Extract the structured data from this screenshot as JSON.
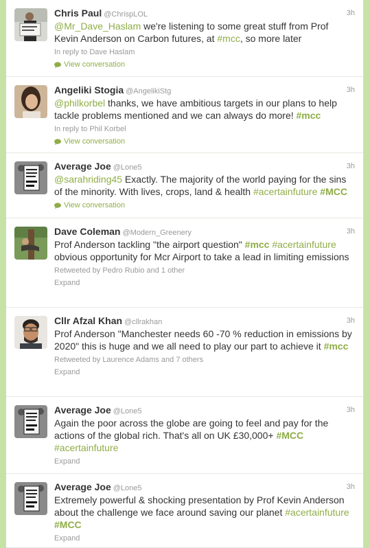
{
  "colors": {
    "accent": "#8fad46",
    "background": "#c6e2a6",
    "muted": "#999999",
    "text": "#333333"
  },
  "tweets": [
    {
      "name": "Chris Paul",
      "handle": "@ChrispLOL",
      "time": "3h",
      "text": {
        "mention": "@Mr_Dave_Haslam",
        "body1": " we're listening to some great stuff from Prof Kevin Anderson on Carbon futures, at ",
        "tag1": "#mcc",
        "body2": ", so more later"
      },
      "meta": "In reply to Dave Haslam",
      "action": "View conversation",
      "avatar_icon": "person-holding-sign-icon"
    },
    {
      "name": "Angeliki Stogia",
      "handle": "@AngelikiStg",
      "time": "3h",
      "text": {
        "mention": "@philkorbel",
        "body1": " thanks, we have ambitious targets in our plans to help tackle problems mentioned and we can always do more! ",
        "tag1": "#mcc"
      },
      "meta": "In reply to Phil Korbel",
      "action": "View conversation",
      "avatar_icon": "woman-portrait-icon"
    },
    {
      "name": "Average Joe",
      "handle": "@Lone5",
      "time": "3h",
      "text": {
        "mention": "@sarahriding45",
        "body1": " Exactly. The majority of the world paying for the sins of the minority. With lives, crops, land & health ",
        "tag1": "#acertainfuture",
        "body2": " ",
        "tag2": "#MCC"
      },
      "action": "View conversation",
      "avatar_icon": "protest-placard-icon"
    },
    {
      "name": "Dave Coleman",
      "handle": "@Modern_Greenery",
      "time": "3h",
      "text": {
        "body1": "Prof Anderson tackling \"the airport question\" ",
        "tag1": "#mcc",
        "body2": " ",
        "tag2": "#acertainfuture",
        "body3": " obvious opportunity for Mcr Airport to take a lead in limiting emissions"
      },
      "meta": "Retweeted by Pedro Rubio and 1 other",
      "action": "Expand",
      "avatar_icon": "tree-hug-icon"
    },
    {
      "name": "Cllr Afzal Khan",
      "handle": "@cllrakhan",
      "time": "3h",
      "text": {
        "body1": "Prof Anderson \"Manchester needs 60 -70 % reduction in emissions by 2020\" this is huge and we all need to play our part to achieve it ",
        "tag1": "#mcc"
      },
      "meta": "Retweeted by Laurence Adams and 7 others",
      "action": "Expand",
      "avatar_icon": "man-portrait-icon"
    },
    {
      "name": "Average Joe",
      "handle": "@Lone5",
      "time": "3h",
      "text": {
        "body1": "Again the poor across the globe are going to feel and pay for the actions of the global rich. That's all on UK £30,000+ ",
        "tag1": "#MCC",
        "body2": " ",
        "tag2": "#acertainfuture"
      },
      "action": "Expand",
      "avatar_icon": "protest-placard-icon"
    },
    {
      "name": "Average Joe",
      "handle": "@Lone5",
      "time": "3h",
      "text": {
        "body1": "Extremely powerful & shocking presentation by Prof Kevin Anderson about the challenge we face around saving our planet ",
        "tag1": "#acertainfuture",
        "body2": " ",
        "tag2": "#MCC"
      },
      "action": "Expand",
      "avatar_icon": "protest-placard-icon"
    }
  ]
}
